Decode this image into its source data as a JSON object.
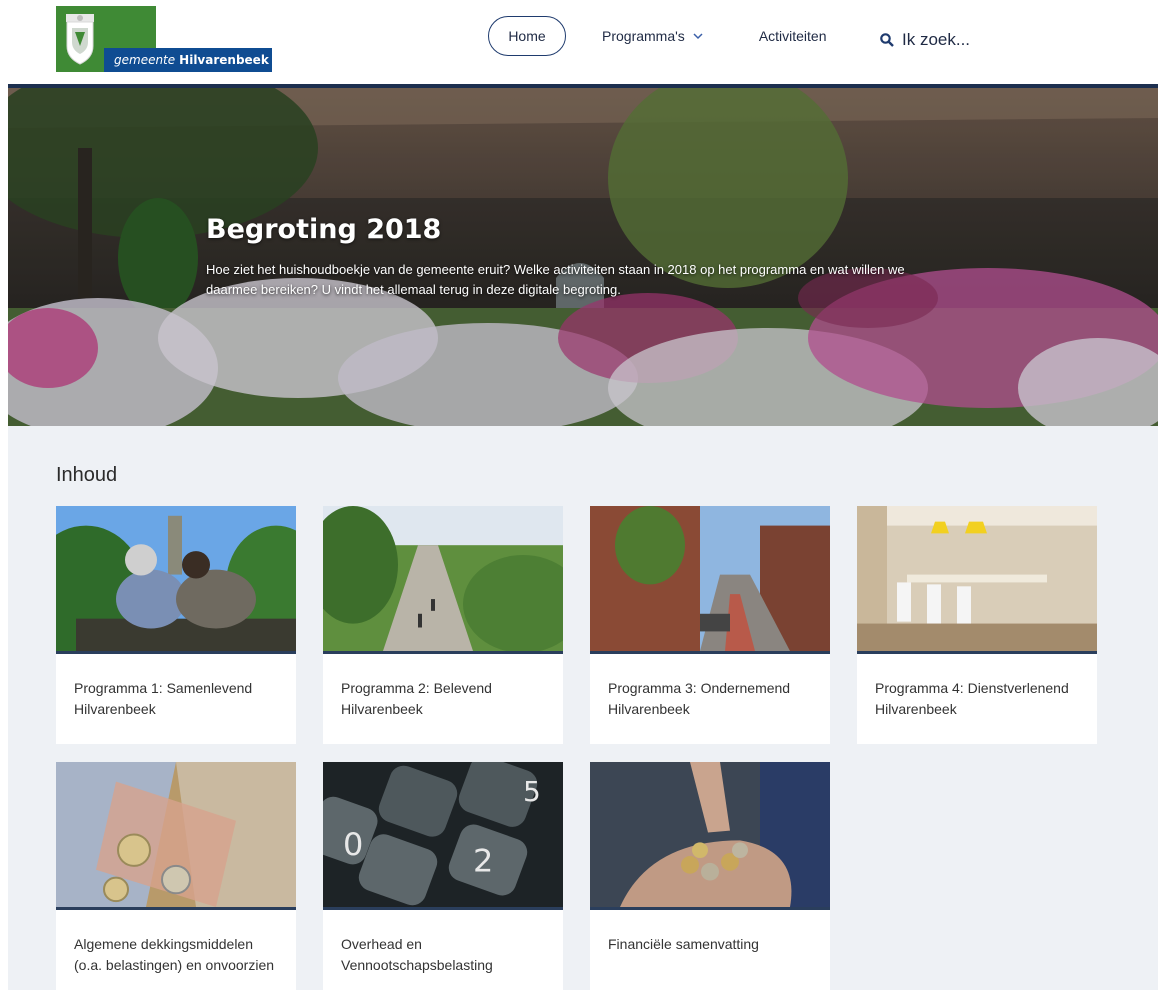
{
  "header": {
    "logo": {
      "pre": "gemeente",
      "post": "Hilvarenbeek"
    },
    "nav": {
      "home": "Home",
      "programmas": "Programma's",
      "activiteiten": "Activiteiten",
      "search": "Ik zoek..."
    }
  },
  "hero": {
    "title": "Begroting 2018",
    "text": "Hoe ziet het huishoudboekje van de gemeente eruit? Welke activiteiten staan in 2018 op het programma en wat willen we daarmee bereiken? U vindt het allemaal terug in deze digitale begroting."
  },
  "content": {
    "title": "Inhoud",
    "cards": [
      {
        "label": "Programma 1: Samenlevend Hilvarenbeek"
      },
      {
        "label": "Programma 2: Belevend Hilvarenbeek"
      },
      {
        "label": "Programma 3: Ondernemend Hilvarenbeek"
      },
      {
        "label": "Programma 4: Dienstverlenend Hilvarenbeek"
      },
      {
        "label": "Algemene dekkingsmiddelen (o.a. belastingen) en onvoorzien"
      },
      {
        "label": "Overhead en Vennootschapsbelasting"
      },
      {
        "label": "Financiële samenvatting"
      }
    ]
  },
  "colors": {
    "brand_green": "#3f8a35",
    "brand_blue": "#0f4c92",
    "nav_dark": "#1f3b6e",
    "page_bg": "#eef1f5"
  }
}
